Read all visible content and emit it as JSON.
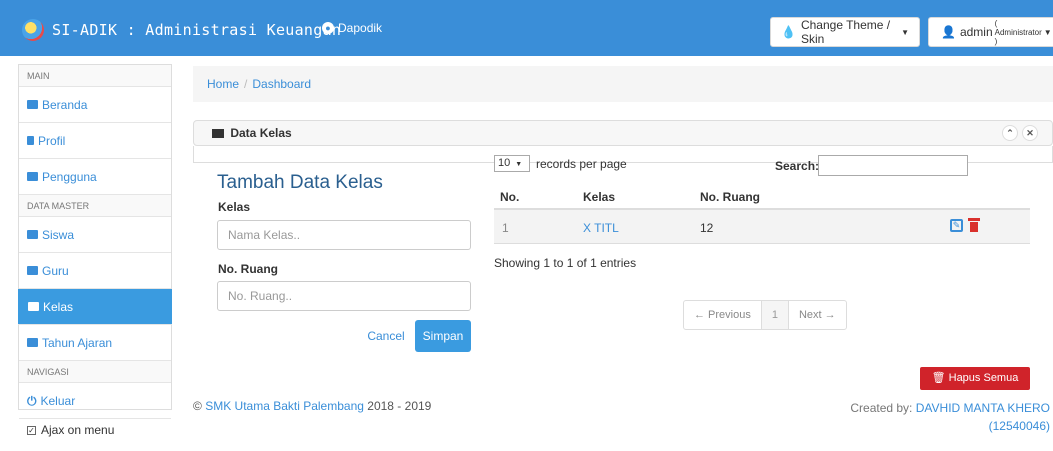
{
  "navbar": {
    "brand": "SI-ADIK : Administrasi Keuangan",
    "dapodik": "Dapodik",
    "theme_btn": "Change Theme / Skin",
    "user": "admin",
    "role": "( Administrator )"
  },
  "sidebar": {
    "head_main": "MAIN",
    "item_beranda": "Beranda",
    "item_profil": "Profil",
    "item_pengguna": "Pengguna",
    "head_master": "DATA MASTER",
    "item_siswa": "Siswa",
    "item_guru": "Guru",
    "item_kelas": "Kelas",
    "item_tahun": "Tahun Ajaran",
    "head_nav": "NAVIGASI",
    "item_keluar": "Keluar",
    "ajax": "Ajax on menu"
  },
  "breadcrumb": {
    "home": "Home",
    "sep": "/",
    "current": "Dashboard"
  },
  "panel": {
    "title": "Data Kelas",
    "collapse": "⌃",
    "close": "✕"
  },
  "form": {
    "title": "Tambah Data Kelas",
    "kelas_label": "Kelas",
    "kelas_placeholder": "Nama Kelas..",
    "ruang_label": "No. Ruang",
    "ruang_placeholder": "No. Ruang..",
    "cancel": "Cancel",
    "save": "Simpan"
  },
  "table": {
    "length_value": "10",
    "length_text": "records per page",
    "search_label": "Search:",
    "headers": [
      "No.",
      "Kelas",
      "No. Ruang"
    ],
    "rows": [
      {
        "no": "1",
        "kelas": "X TITL",
        "ruang": "12"
      }
    ],
    "info": "Showing 1 to 1 of 1 entries",
    "prev": "← Previous",
    "page": "1",
    "next": "Next →",
    "delete_all": "Hapus Semua Data"
  },
  "footer": {
    "copyright": "©",
    "school": "SMK Utama Bakti Palembang",
    "years": "2018 - 2019",
    "created_by": "Created by:",
    "author": "DAVHID MANTA KHERO",
    "author_id": "(12540046)"
  },
  "colors": {
    "primary": "#3a8ed8",
    "danger": "#d0232a",
    "active": "#3a9be0"
  }
}
